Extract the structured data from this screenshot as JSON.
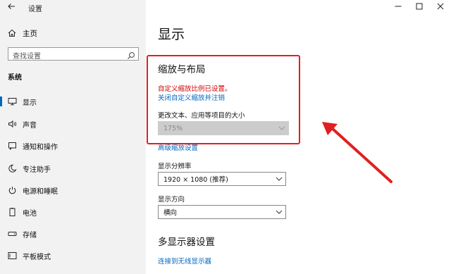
{
  "window": {
    "title": "设置",
    "back_icon": "back-arrow-icon",
    "controls": [
      "minimize-icon",
      "maximize-icon",
      "close-icon"
    ]
  },
  "sidebar": {
    "home_label": "主页",
    "search_placeholder": "查找设置",
    "section": "系统",
    "items": [
      {
        "label": "显示",
        "icon": "monitor-icon",
        "active": true
      },
      {
        "label": "声音",
        "icon": "speaker-icon"
      },
      {
        "label": "通知和操作",
        "icon": "notification-icon"
      },
      {
        "label": "专注助手",
        "icon": "moon-icon"
      },
      {
        "label": "电源和睡眠",
        "icon": "power-icon"
      },
      {
        "label": "电池",
        "icon": "battery-icon"
      },
      {
        "label": "存储",
        "icon": "storage-icon"
      },
      {
        "label": "平板模式",
        "icon": "tablet-icon"
      }
    ]
  },
  "main": {
    "title": "显示",
    "scale_heading": "缩放与布局",
    "custom_scale_warning": "自定义缩放比例已设置。",
    "turn_off_custom_link": "关闭自定义缩放并注销",
    "change_size_label": "更改文本、应用等项目的大小",
    "scale_value": "175%",
    "advanced_scaling_link": "高级缩放设置",
    "resolution_label": "显示分辨率",
    "resolution_value": "1920 × 1080 (推荐)",
    "orientation_label": "显示方向",
    "orientation_value": "横向",
    "multi_display_heading": "多显示器设置",
    "wireless_link": "连接到无线显示器"
  },
  "annotation": {
    "highlight_color": "#e02020"
  },
  "colors": {
    "accent": "#0067c0",
    "warning": "#d40000",
    "sidebar_bg": "#f2f2f2"
  }
}
